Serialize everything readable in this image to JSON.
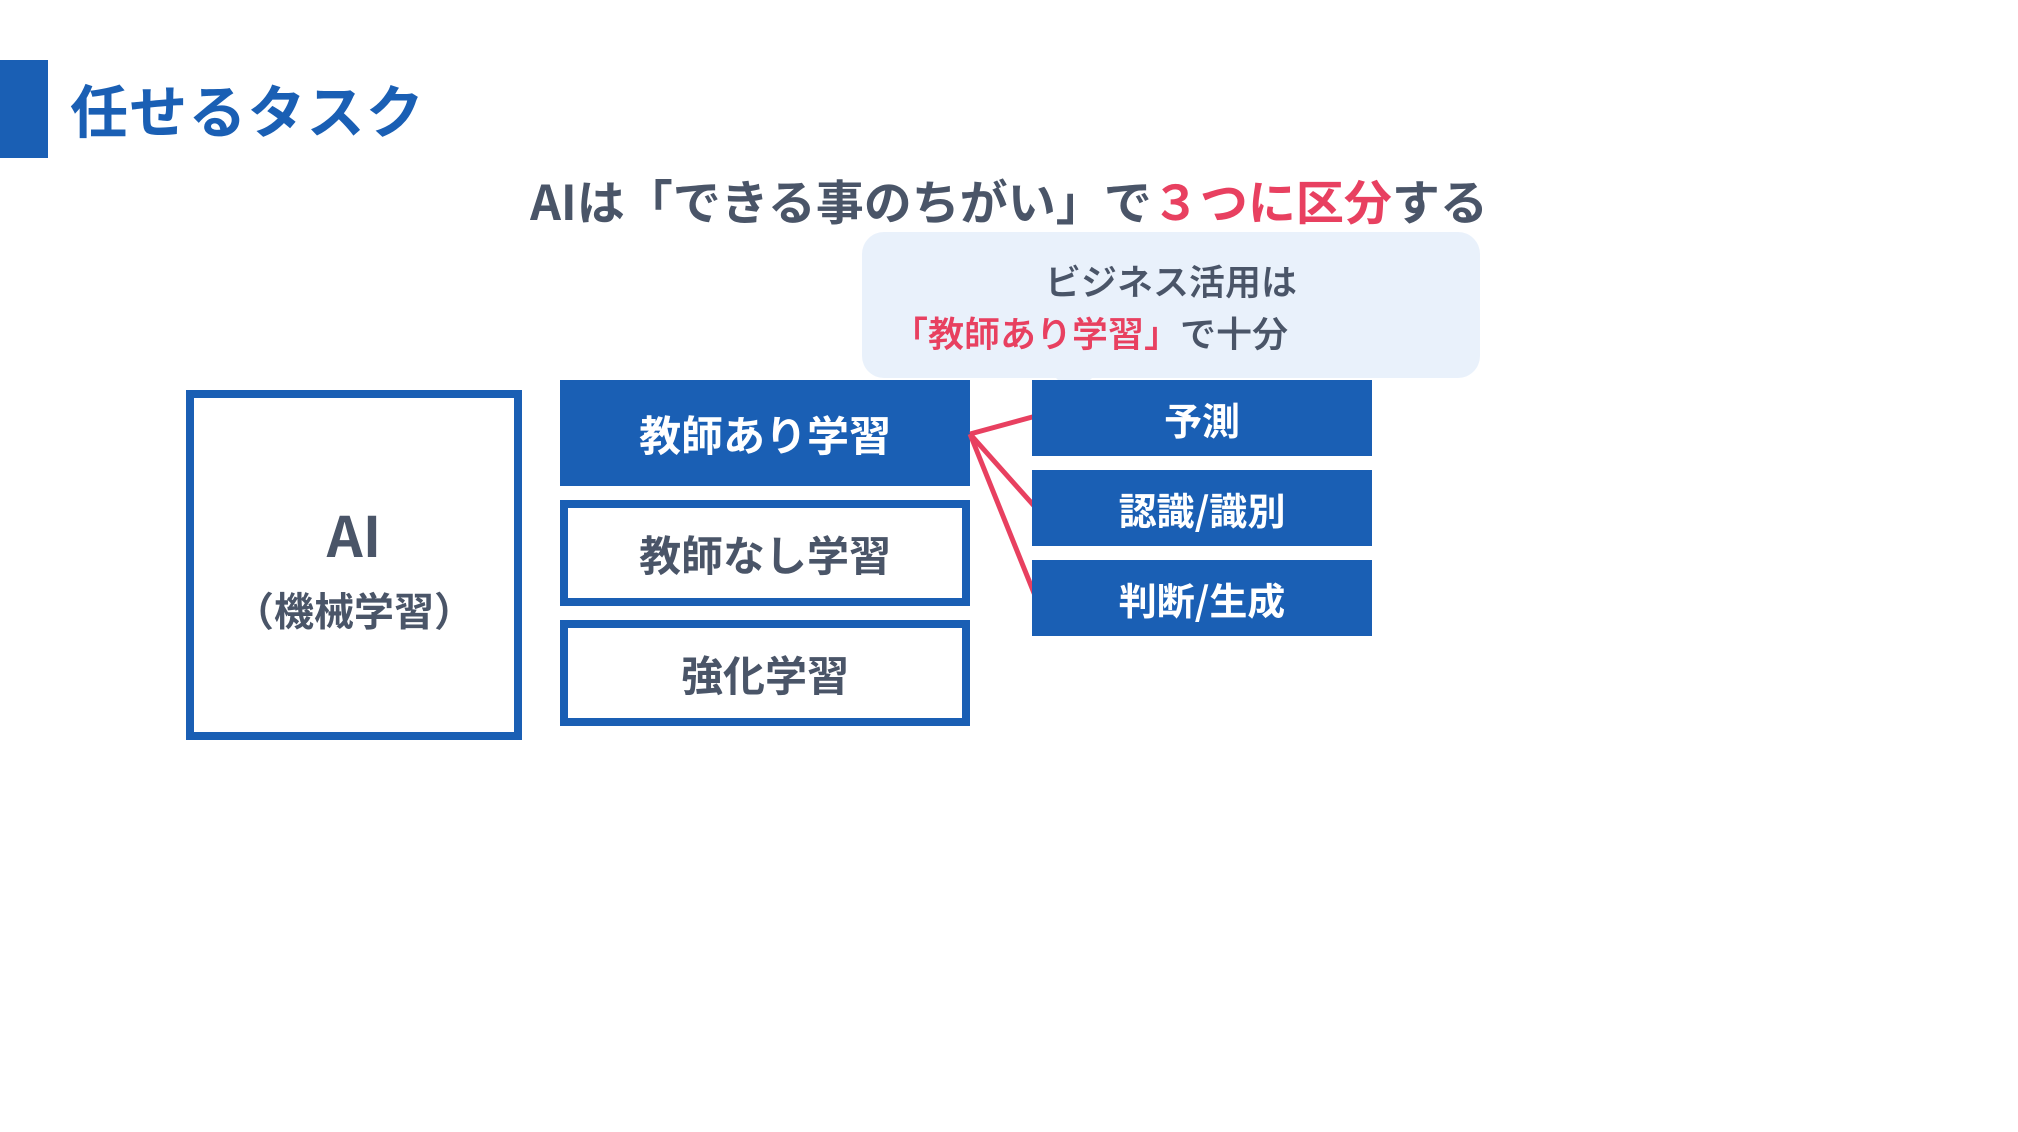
{
  "title": "任せるタスク",
  "subhead": {
    "before": "AIは「できる事のちがい」で",
    "accent": "３つに区分",
    "after": "する"
  },
  "bubble": {
    "line1": "ビジネス活用は",
    "line2_accent": "「教師あり学習」",
    "line2_after": "で十分"
  },
  "ai": {
    "main": "AI",
    "sub": "（機械学習）"
  },
  "types": [
    {
      "label": "教師あり学習",
      "fill": true
    },
    {
      "label": "教師なし学習",
      "fill": false
    },
    {
      "label": "強化学習",
      "fill": false
    }
  ],
  "tasks": [
    {
      "label": "予測"
    },
    {
      "label": "認識/識別"
    },
    {
      "label": "判断/生成"
    }
  ],
  "colors": {
    "primary": "#1a5fb4",
    "accent": "#e84060",
    "text": "#4a5568",
    "bubbleBg": "#e9f1fb"
  }
}
